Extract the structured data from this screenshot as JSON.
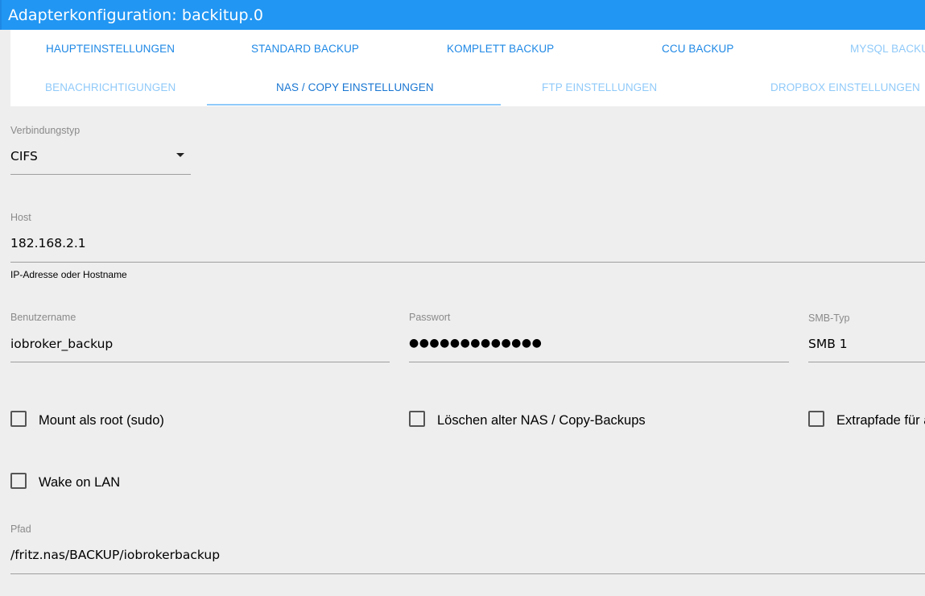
{
  "window": {
    "title": "Adapterkonfiguration: backitup.0"
  },
  "tabs": {
    "row1": [
      {
        "label": "HAUPTEINSTELLUNGEN"
      },
      {
        "label": "STANDARD BACKUP"
      },
      {
        "label": "KOMPLETT BACKUP"
      },
      {
        "label": "CCU BACKUP"
      },
      {
        "label": "MYSQL BACKUP"
      }
    ],
    "row2": [
      {
        "label": "BENACHRICHTIGUNGEN"
      },
      {
        "label": "NAS / COPY EINSTELLUNGEN",
        "active": true
      },
      {
        "label": "FTP EINSTELLUNGEN"
      },
      {
        "label": "DROPBOX EINSTELLUNGEN"
      }
    ]
  },
  "form": {
    "connection_type": {
      "label": "Verbindungstyp",
      "value": "CIFS"
    },
    "host": {
      "label": "Host",
      "value": "182.168.2.1",
      "helper": "IP-Adresse oder Hostname"
    },
    "username": {
      "label": "Benutzername",
      "value": "iobroker_backup"
    },
    "password": {
      "label": "Passwort",
      "value": "●●●●●●●●●●●●●"
    },
    "smb_type": {
      "label": "SMB-Typ",
      "value": "SMB 1"
    },
    "checkboxes": {
      "mount_root": {
        "label": "Mount als root (sudo)",
        "checked": false
      },
      "delete_old": {
        "label": "Löschen alter NAS / Copy-Backups",
        "checked": false
      },
      "extra_paths": {
        "label": "Extrapfade für a",
        "checked": false
      },
      "wake_on_lan": {
        "label": "Wake on LAN",
        "checked": false
      }
    },
    "path": {
      "label": "Pfad",
      "value": "/fritz.nas/BACKUP/iobrokerbackup"
    }
  },
  "colors": {
    "titlebar": "#2196f3",
    "tab_text": "#1e88e5",
    "tab_dim": "#90caf9",
    "background": "#eeeeee"
  }
}
